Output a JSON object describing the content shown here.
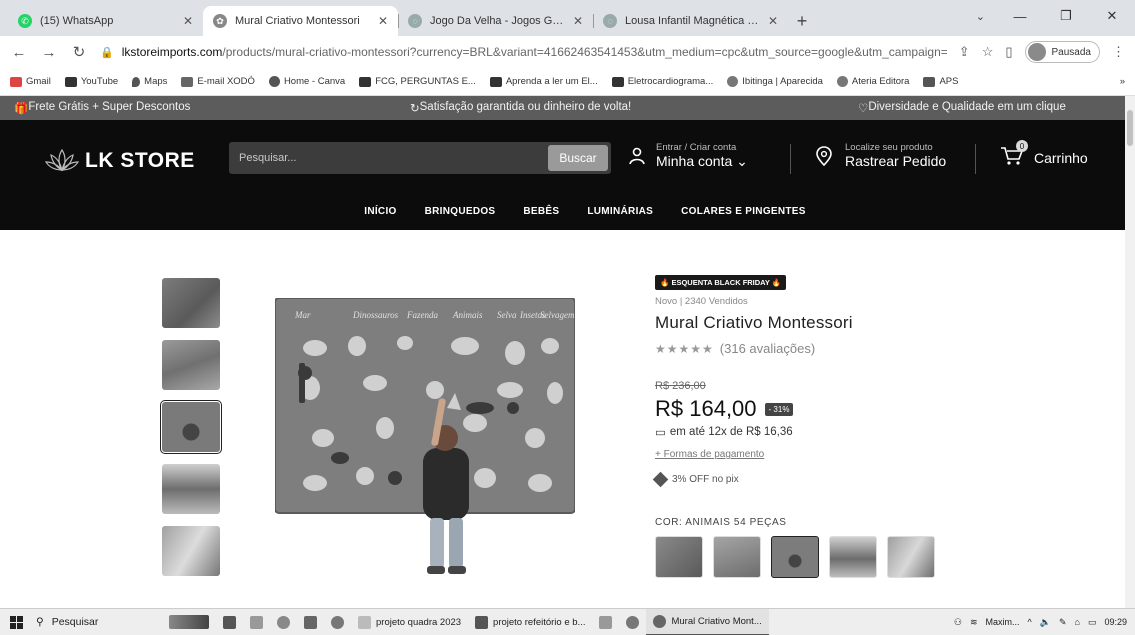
{
  "browser": {
    "tabs": [
      {
        "title": "(15) WhatsApp",
        "active": false,
        "favicon_color": "#25d366"
      },
      {
        "title": "Mural Criativo Montessori",
        "active": true,
        "favicon_color": "#888888"
      },
      {
        "title": "Jogo Da Velha - Jogos Gigantes",
        "active": false,
        "favicon_color": "#9aa"
      },
      {
        "title": "Lousa Infantil Magnética Quadr",
        "active": false,
        "favicon_color": "#9aa"
      }
    ],
    "new_tab_label": "+",
    "address": {
      "host": "lkstoreimports.com",
      "path": "/products/mural-criativo-montessori?currency=BRL&variant=41662463541453&utm_medium=cpc&utm_source=google&utm_campaign=..."
    },
    "profile_label": "Pausada",
    "bookmarks": [
      {
        "label": "Gmail",
        "color": "#d44"
      },
      {
        "label": "YouTube",
        "color": "#333"
      },
      {
        "label": "Maps",
        "color": "#555"
      },
      {
        "label": "E-mail XODÓ",
        "color": "#666"
      },
      {
        "label": "Home - Canva",
        "color": "#555"
      },
      {
        "label": "FCG, PERGUNTAS E...",
        "color": "#333"
      },
      {
        "label": "Aprenda a ler um El...",
        "color": "#333"
      },
      {
        "label": "Eletrocardiograma...",
        "color": "#333"
      },
      {
        "label": "Ibitinga | Aparecida",
        "color": "#777"
      },
      {
        "label": "Ateria Editora",
        "color": "#777"
      },
      {
        "label": "APS",
        "color": "#555"
      }
    ],
    "bookmarks_more": "»"
  },
  "store": {
    "promo": [
      "Frete Grátis + Super Descontos",
      "Satisfação garantida ou dinheiro de volta!",
      "Diversidade e Qualidade em um clique"
    ],
    "logo_text": "LK STORE",
    "search_placeholder": "Pesquisar...",
    "search_button": "Buscar",
    "account_small": "Entrar / Criar conta",
    "account_big": "Minha conta",
    "track_small": "Localize seu produto",
    "track_big": "Rastrear Pedido",
    "cart_label": "Carrinho",
    "cart_count": "0",
    "nav": [
      "INÍCIO",
      "BRINQUEDOS",
      "BEBÊS",
      "LUMINÁRIAS",
      "COLARES E PINGENTES"
    ]
  },
  "product": {
    "badge": "ESQUENTA BLACK FRIDAY",
    "sold": "Novo | 2340 Vendidos",
    "title": "Mural Criativo Montessori",
    "stars": "★★★★★",
    "reviews": "(316 avaliações)",
    "old_price": "R$ 236,00",
    "price": "R$ 164,00",
    "discount": "- 31%",
    "installments": "em até 12x de R$ 16,36",
    "payment_link": "+ Formas de pagamento",
    "pix": "3% OFF no pix",
    "variant_label": "COR: ANIMAIS 54 PEÇAS",
    "image_heading_words": [
      "Mar",
      "Dinossauros",
      "Fazenda",
      "Animais",
      "Selva",
      "Insetos",
      "Selvagem"
    ]
  },
  "taskbar": {
    "search_label": "Pesquisar",
    "items": [
      "projeto quadra 2023",
      "projeto refeitório e b...",
      "Mural Criativo Mont..."
    ],
    "tray_label": "Maxim...",
    "time": "09:29"
  }
}
